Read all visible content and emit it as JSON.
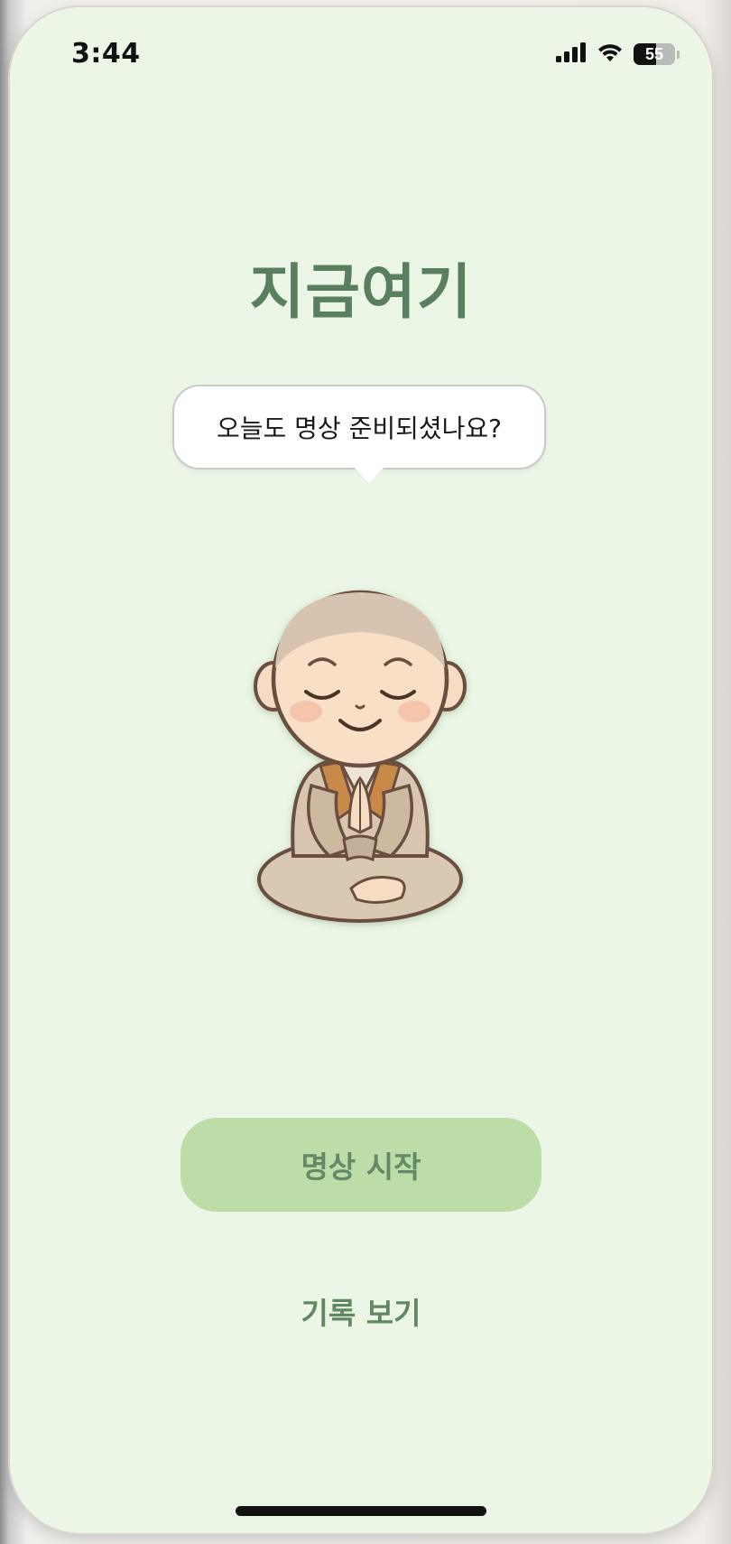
{
  "status_bar": {
    "time": "3:44",
    "battery_level": "55",
    "battery_percent": 55,
    "signal_icon": "cellular-signal-icon",
    "wifi_icon": "wifi-icon"
  },
  "main": {
    "title": "지금여기",
    "speech_bubble": "오늘도 명상 준비되셨나요?",
    "character_icon": "meditating-monk-illustration"
  },
  "actions": {
    "start_label": "명상 시작",
    "history_label": "기록 보기"
  },
  "colors": {
    "background": "#ebf6e6",
    "title": "#5a7f5f",
    "primary_button": "#bcdca8",
    "primary_button_text": "#638a67"
  }
}
